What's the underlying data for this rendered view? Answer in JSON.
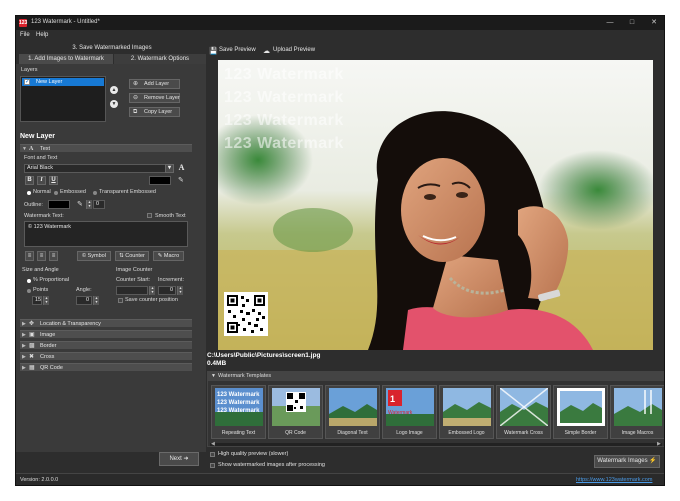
{
  "window": {
    "app_icon": "123",
    "title": "123 Watermark - Untitled*",
    "minimize_icon": "minimize-icon",
    "maximize_icon": "maximize-icon",
    "close_icon": "close-icon"
  },
  "menu": {
    "file": "File",
    "help": "Help"
  },
  "steps": {
    "step3": "3. Save Watermarked Images",
    "step1": "1. Add Images to Watermark",
    "step2": "2. Watermark Options"
  },
  "layers": {
    "label": "Layers",
    "items": [
      {
        "name": "New Layer",
        "checked": true
      }
    ],
    "add": "Add Layer",
    "remove": "Remove Layer",
    "copy": "Copy Layer"
  },
  "new_layer_title": "New Layer",
  "text_section": {
    "header": "Text",
    "font_and_text": "Font and Text",
    "font": "Arial Black",
    "bold": "B",
    "italic": "I",
    "underline": "U",
    "style_normal": "Normal",
    "style_embossed": "Embossed",
    "style_transparent": "Transparent Embossed",
    "outline_label": "Outline:",
    "outline_value": "0",
    "watermark_text_label": "Watermark Text:",
    "smooth_text": "Smooth Text",
    "watermark_text": "© 123 Watermark",
    "symbol": "Symbol",
    "counter": "Counter",
    "macro": "Macro"
  },
  "size_angle": {
    "title": "Size and Angle",
    "proportional": "% Proportional",
    "points": "Points",
    "size_value": "15",
    "angle_label": "Angle:",
    "angle_value": "0"
  },
  "image_counter": {
    "title": "Image Counter",
    "start_label": "Counter Start:",
    "increment_label": "Increment:",
    "increment_value": "0",
    "save_position": "Save counter position"
  },
  "collapsed_sections": [
    {
      "label": "Location & Transparency",
      "icon": "move-icon"
    },
    {
      "label": "Image",
      "icon": "image-icon"
    },
    {
      "label": "Border",
      "icon": "border-icon"
    },
    {
      "label": "Cross",
      "icon": "cross-icon"
    },
    {
      "label": "QR Code",
      "icon": "qr-icon"
    }
  ],
  "next_button": "Next",
  "toolbar": {
    "save_preview": "Save Preview",
    "upload_preview": "Upload Preview"
  },
  "preview": {
    "watermark_lines": [
      "123 Watermark",
      "123 Watermark",
      "123 Watermark",
      "123 Watermark"
    ]
  },
  "file_info": {
    "path": "C:\\Users\\Public\\Pictures\\screen1.jpg",
    "size": "0.4MB"
  },
  "templates": {
    "header": "Watermark Templates",
    "items": [
      "Repeating Text",
      "QR Code",
      "Diagonal Text",
      "Logo Image",
      "Embossed Logo",
      "Watermark Cross",
      "Simple Border",
      "Image Macros"
    ]
  },
  "options": {
    "high_quality": "High quality preview (slower)",
    "show_after": "Show watermarked images after processing"
  },
  "watermark_images_button": "Watermark Images",
  "status": {
    "version": "Version: 2.0.0.0",
    "link": "https://www.123watermark.com"
  },
  "colors": {
    "accent": "#1779d4",
    "brand_red": "#d9232d",
    "link": "#4a9be8"
  }
}
